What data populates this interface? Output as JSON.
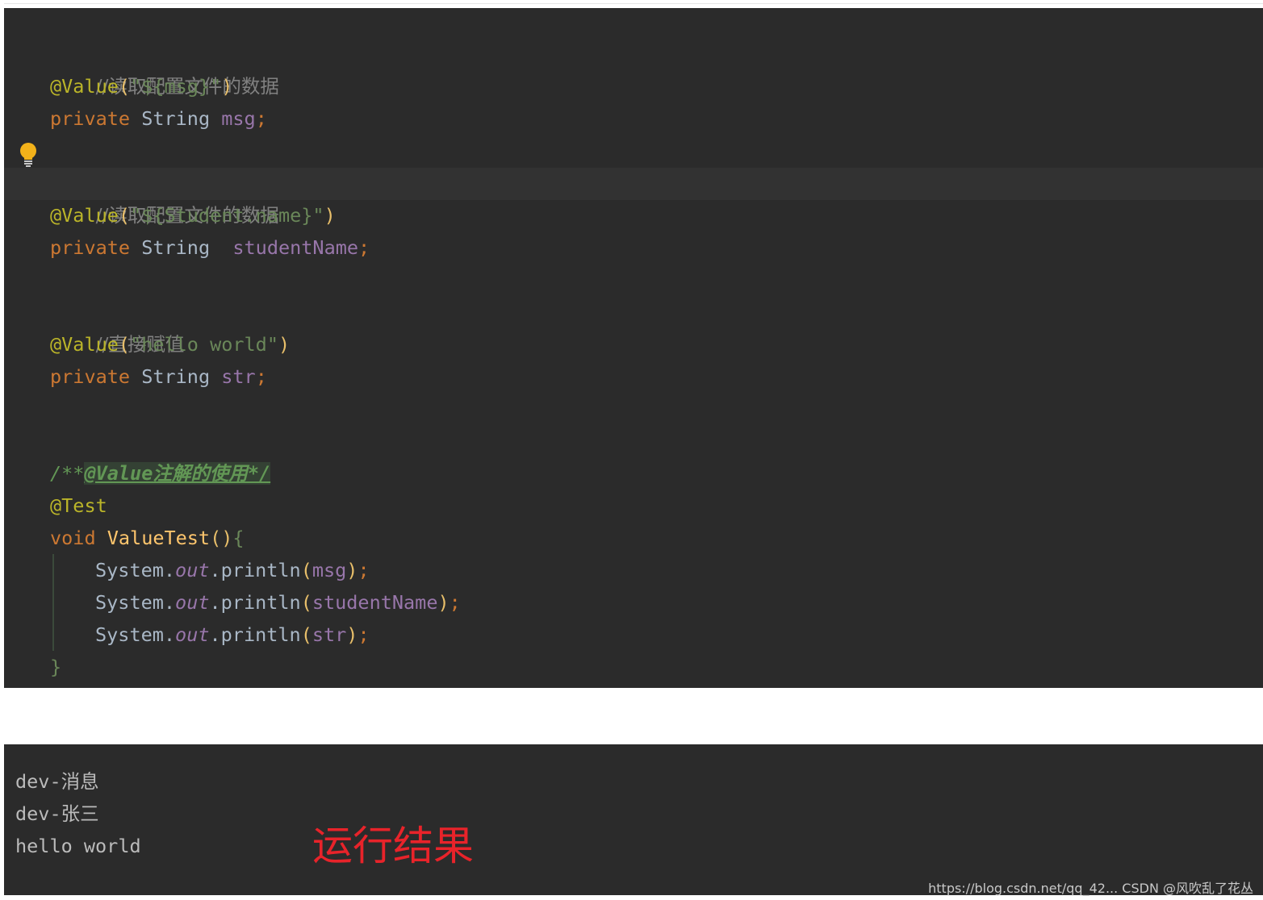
{
  "colors": {
    "editor_bg": "#2b2b2b",
    "comment": "#808080",
    "annotation": "#bbb529",
    "string": "#6a8759",
    "keyword": "#cc7832",
    "field": "#9876aa",
    "method": "#ffc66d",
    "doc_comment": "#629755",
    "result_label": "#e8232a"
  },
  "icons": {
    "intention": "lightbulb-icon"
  },
  "editor": {
    "block1": {
      "comment": "//读取配置文件的数据",
      "ann_name": "@Value",
      "ann_open": "(",
      "ann_arg": "\"${msg}\"",
      "ann_close": ")",
      "kw": "private",
      "type": "String",
      "gap": " ",
      "field": "msg",
      "semi": ";"
    },
    "block2": {
      "comment": "//读取配置文件的数据",
      "ann_name": "@Value",
      "ann_open": "(",
      "ann_arg": "\"${Student.name}\"",
      "ann_close": ")",
      "kw": "private",
      "type": "String",
      "gap": "  ",
      "field": "studentName",
      "semi": ";"
    },
    "block3": {
      "comment": "//直接赋值",
      "ann_name": "@Value",
      "ann_open": "(",
      "ann_arg": "\"hello world\"",
      "ann_close": ")",
      "kw": "private",
      "type": "String",
      "gap": " ",
      "field": "str",
      "semi": ";"
    },
    "method": {
      "doc_prefix": "/**",
      "doc_body": "@Value注解的使用*/",
      "annotation": "@Test",
      "kw": "void",
      "name": "ValueTest",
      "parens": "()",
      "open_brace": "{",
      "close_brace": "}",
      "statements": [
        {
          "cls": "System",
          "dot1": ".",
          "out": "out",
          "call": ".println",
          "open": "(",
          "arg": "msg",
          "close": ")",
          "semi": ";"
        },
        {
          "cls": "System",
          "dot1": ".",
          "out": "out",
          "call": ".println",
          "open": "(",
          "arg": "studentName",
          "close": ")",
          "semi": ";"
        },
        {
          "cls": "System",
          "dot1": ".",
          "out": "out",
          "call": ".println",
          "open": "(",
          "arg": "str",
          "close": ")",
          "semi": ";"
        }
      ]
    }
  },
  "console": {
    "lines": [
      "dev-消息",
      "dev-张三",
      "hello world"
    ],
    "label": "运行结果"
  },
  "watermark": "https://blog.csdn.net/qq_42... CSDN @风吹乱了花丛"
}
